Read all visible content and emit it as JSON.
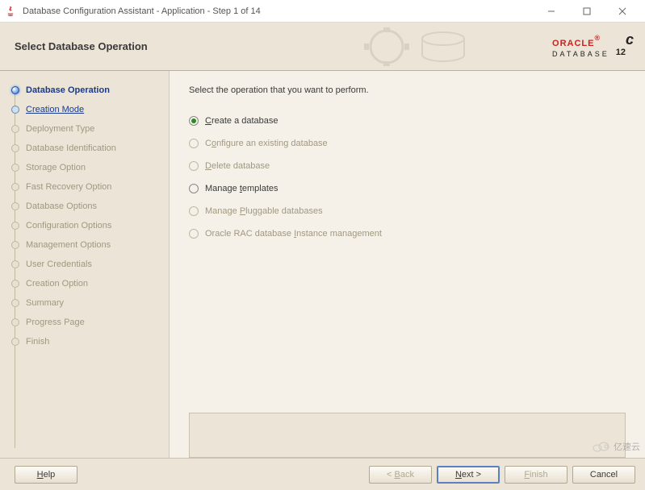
{
  "window": {
    "title": "Database Configuration Assistant - Application - Step 1 of 14"
  },
  "header": {
    "title": "Select Database Operation",
    "brand_main": "ORACLE",
    "brand_sub": "DATABASE",
    "brand_version": "12",
    "brand_version_sufx": "c"
  },
  "sidebar": {
    "items": [
      {
        "label": "Database Operation",
        "state": "current"
      },
      {
        "label": "Creation Mode",
        "state": "next"
      },
      {
        "label": "Deployment Type",
        "state": "disabled"
      },
      {
        "label": "Database Identification",
        "state": "disabled"
      },
      {
        "label": "Storage Option",
        "state": "disabled"
      },
      {
        "label": "Fast Recovery Option",
        "state": "disabled"
      },
      {
        "label": "Database Options",
        "state": "disabled"
      },
      {
        "label": "Configuration Options",
        "state": "disabled"
      },
      {
        "label": "Management Options",
        "state": "disabled"
      },
      {
        "label": "User Credentials",
        "state": "disabled"
      },
      {
        "label": "Creation Option",
        "state": "disabled"
      },
      {
        "label": "Summary",
        "state": "disabled"
      },
      {
        "label": "Progress Page",
        "state": "disabled"
      },
      {
        "label": "Finish",
        "state": "disabled"
      }
    ]
  },
  "main": {
    "instruction": "Select the operation that you want to perform.",
    "options": [
      {
        "pre": "",
        "mn": "C",
        "post": "reate a database",
        "enabled": true,
        "selected": true
      },
      {
        "pre": "C",
        "mn": "o",
        "post": "nfigure an existing database",
        "enabled": false,
        "selected": false
      },
      {
        "pre": "",
        "mn": "D",
        "post": "elete database",
        "enabled": false,
        "selected": false
      },
      {
        "pre": "Manage ",
        "mn": "t",
        "post": "emplates",
        "enabled": true,
        "selected": false
      },
      {
        "pre": "Manage ",
        "mn": "P",
        "post": "luggable databases",
        "enabled": false,
        "selected": false
      },
      {
        "pre": "Oracle RAC database ",
        "mn": "I",
        "post": "nstance management",
        "enabled": false,
        "selected": false
      }
    ]
  },
  "footer": {
    "help": "Help",
    "back": "< Back",
    "next": "Next >",
    "finish": "Finish",
    "cancel": "Cancel",
    "help_mn": "H",
    "back_mn": "B",
    "next_mn": "N",
    "finish_mn": "F"
  },
  "watermark": "亿速云"
}
